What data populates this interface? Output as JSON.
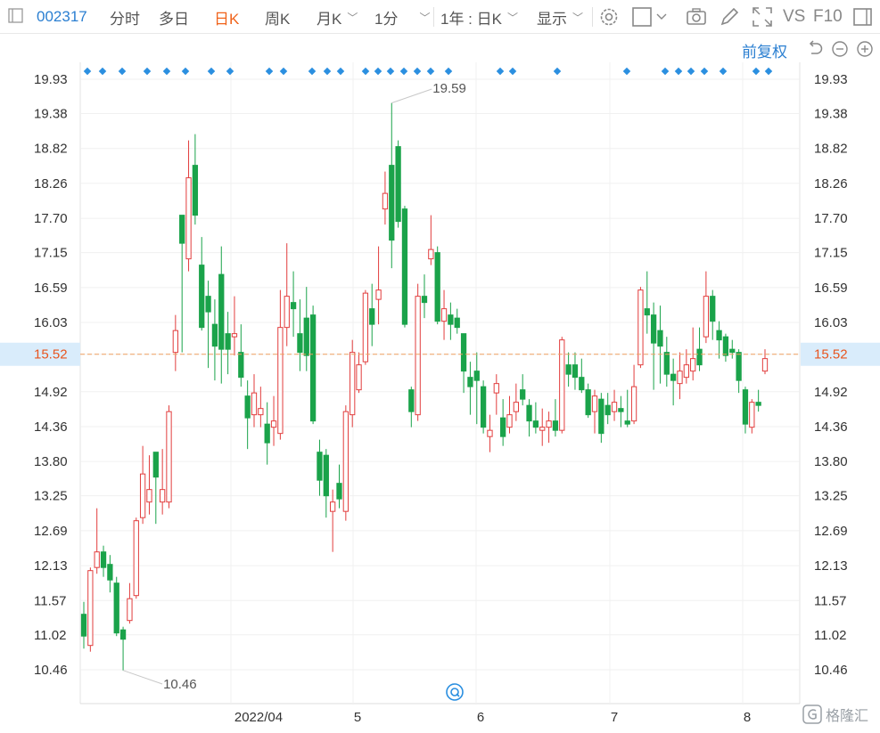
{
  "toolbar": {
    "code": "002317",
    "items": [
      "分时",
      "多日",
      "日K",
      "周K",
      "月K",
      "1分",
      "1年 : 日K",
      "显示"
    ],
    "active_index": 2,
    "vs": "VS",
    "f10": "F10"
  },
  "adjust_label": "前复权",
  "watermark": "格隆汇",
  "chart_data": {
    "type": "candlestick",
    "y_ticks": [
      "19.93",
      "19.38",
      "18.82",
      "18.26",
      "17.70",
      "17.15",
      "16.59",
      "16.03",
      "15.52",
      "14.92",
      "14.36",
      "13.80",
      "13.25",
      "12.69",
      "12.13",
      "11.57",
      "11.02",
      "10.46"
    ],
    "ylim": [
      10.46,
      19.93
    ],
    "x_labels": [
      "2022/04",
      "5",
      "6",
      "7",
      "8"
    ],
    "current_price": "15.52",
    "high_label": "19.59",
    "low_label": "10.46",
    "up_color": "#e23d3d",
    "down_color": "#1aa34a",
    "candles": [
      {
        "o": 11.35,
        "c": 11.0,
        "h": 11.55,
        "l": 10.8
      },
      {
        "o": 10.85,
        "c": 12.05,
        "h": 12.1,
        "l": 10.75
      },
      {
        "o": 12.1,
        "c": 12.35,
        "h": 13.05,
        "l": 12.0
      },
      {
        "o": 12.35,
        "c": 12.1,
        "h": 12.45,
        "l": 11.95
      },
      {
        "o": 12.15,
        "c": 11.9,
        "h": 12.3,
        "l": 11.7
      },
      {
        "o": 11.85,
        "c": 11.05,
        "h": 11.95,
        "l": 11.0
      },
      {
        "o": 11.1,
        "c": 10.95,
        "h": 11.15,
        "l": 10.45
      },
      {
        "o": 11.25,
        "c": 11.6,
        "h": 11.85,
        "l": 11.2
      },
      {
        "o": 11.65,
        "c": 12.85,
        "h": 12.9,
        "l": 11.6
      },
      {
        "o": 12.9,
        "c": 13.6,
        "h": 14.05,
        "l": 12.8
      },
      {
        "o": 13.15,
        "c": 13.35,
        "h": 13.9,
        "l": 12.95
      },
      {
        "o": 13.95,
        "c": 13.55,
        "h": 13.95,
        "l": 12.8
      },
      {
        "o": 13.15,
        "c": 13.35,
        "h": 14.0,
        "l": 12.95
      },
      {
        "o": 13.15,
        "c": 14.6,
        "h": 14.7,
        "l": 13.05
      },
      {
        "o": 15.55,
        "c": 15.9,
        "h": 16.15,
        "l": 15.25
      },
      {
        "o": 17.75,
        "c": 17.3,
        "h": 17.75,
        "l": 15.55
      },
      {
        "o": 17.05,
        "c": 18.35,
        "h": 18.95,
        "l": 16.85
      },
      {
        "o": 18.55,
        "c": 17.75,
        "h": 19.05,
        "l": 17.6
      },
      {
        "o": 16.95,
        "c": 15.95,
        "h": 17.4,
        "l": 15.9
      },
      {
        "o": 16.45,
        "c": 16.2,
        "h": 16.7,
        "l": 15.3
      },
      {
        "o": 16.0,
        "c": 15.65,
        "h": 16.4,
        "l": 15.1
      },
      {
        "o": 16.8,
        "c": 15.6,
        "h": 17.25,
        "l": 15.05
      },
      {
        "o": 15.85,
        "c": 15.6,
        "h": 16.2,
        "l": 15.2
      },
      {
        "o": 15.8,
        "c": 15.85,
        "h": 16.45,
        "l": 15.5
      },
      {
        "o": 15.55,
        "c": 15.15,
        "h": 16.0,
        "l": 15.0
      },
      {
        "o": 14.85,
        "c": 14.5,
        "h": 15.1,
        "l": 14.0
      },
      {
        "o": 14.55,
        "c": 14.9,
        "h": 15.2,
        "l": 14.35
      },
      {
        "o": 14.55,
        "c": 14.65,
        "h": 15.0,
        "l": 14.35
      },
      {
        "o": 14.4,
        "c": 14.1,
        "h": 14.75,
        "l": 13.75
      },
      {
        "o": 14.35,
        "c": 14.45,
        "h": 14.85,
        "l": 14.05
      },
      {
        "o": 14.25,
        "c": 15.95,
        "h": 16.55,
        "l": 14.15
      },
      {
        "o": 15.95,
        "c": 16.45,
        "h": 17.3,
        "l": 15.65
      },
      {
        "o": 16.35,
        "c": 16.25,
        "h": 16.85,
        "l": 15.8
      },
      {
        "o": 15.85,
        "c": 15.55,
        "h": 16.4,
        "l": 15.25
      },
      {
        "o": 16.1,
        "c": 15.5,
        "h": 16.6,
        "l": 15.25
      },
      {
        "o": 16.15,
        "c": 14.45,
        "h": 16.3,
        "l": 14.4
      },
      {
        "o": 13.95,
        "c": 13.5,
        "h": 14.15,
        "l": 13.25
      },
      {
        "o": 13.9,
        "c": 13.25,
        "h": 14.0,
        "l": 12.9
      },
      {
        "o": 13.0,
        "c": 13.15,
        "h": 13.35,
        "l": 12.35
      },
      {
        "o": 13.45,
        "c": 13.2,
        "h": 13.75,
        "l": 13.05
      },
      {
        "o": 13.0,
        "c": 14.6,
        "h": 14.7,
        "l": 12.85
      },
      {
        "o": 14.55,
        "c": 15.55,
        "h": 15.75,
        "l": 14.35
      },
      {
        "o": 14.95,
        "c": 15.35,
        "h": 15.55,
        "l": 14.9
      },
      {
        "o": 15.4,
        "c": 16.5,
        "h": 16.55,
        "l": 15.35
      },
      {
        "o": 16.25,
        "c": 16.0,
        "h": 16.65,
        "l": 15.65
      },
      {
        "o": 16.4,
        "c": 16.55,
        "h": 17.25,
        "l": 16.0
      },
      {
        "o": 17.85,
        "c": 18.1,
        "h": 18.45,
        "l": 17.6
      },
      {
        "o": 18.55,
        "c": 17.35,
        "h": 19.55,
        "l": 16.9
      },
      {
        "o": 18.85,
        "c": 17.65,
        "h": 18.95,
        "l": 17.55
      },
      {
        "o": 17.85,
        "c": 16.0,
        "h": 17.9,
        "l": 15.95
      },
      {
        "o": 14.95,
        "c": 14.6,
        "h": 15.0,
        "l": 14.35
      },
      {
        "o": 14.55,
        "c": 16.45,
        "h": 16.65,
        "l": 14.45
      },
      {
        "o": 16.45,
        "c": 16.35,
        "h": 16.8,
        "l": 16.1
      },
      {
        "o": 17.05,
        "c": 17.2,
        "h": 17.75,
        "l": 16.95
      },
      {
        "o": 17.15,
        "c": 16.05,
        "h": 17.25,
        "l": 16.0
      },
      {
        "o": 16.05,
        "c": 16.25,
        "h": 16.55,
        "l": 15.75
      },
      {
        "o": 16.15,
        "c": 16.0,
        "h": 16.35,
        "l": 15.75
      },
      {
        "o": 16.1,
        "c": 15.95,
        "h": 16.25,
        "l": 15.85
      },
      {
        "o": 15.85,
        "c": 15.25,
        "h": 15.85,
        "l": 14.9
      },
      {
        "o": 15.15,
        "c": 15.0,
        "h": 15.4,
        "l": 14.55
      },
      {
        "o": 15.25,
        "c": 15.1,
        "h": 15.55,
        "l": 14.4
      },
      {
        "o": 15.0,
        "c": 14.35,
        "h": 15.1,
        "l": 14.25
      },
      {
        "o": 14.2,
        "c": 14.3,
        "h": 14.55,
        "l": 13.95
      },
      {
        "o": 14.9,
        "c": 15.05,
        "h": 15.2,
        "l": 14.55
      },
      {
        "o": 14.5,
        "c": 14.2,
        "h": 14.8,
        "l": 14.05
      },
      {
        "o": 14.35,
        "c": 14.55,
        "h": 14.85,
        "l": 14.25
      },
      {
        "o": 14.6,
        "c": 14.75,
        "h": 15.05,
        "l": 14.45
      },
      {
        "o": 14.95,
        "c": 14.8,
        "h": 15.2,
        "l": 14.7
      },
      {
        "o": 14.7,
        "c": 14.45,
        "h": 14.8,
        "l": 14.2
      },
      {
        "o": 14.45,
        "c": 14.35,
        "h": 14.75,
        "l": 14.25
      },
      {
        "o": 14.3,
        "c": 14.35,
        "h": 14.65,
        "l": 14.05
      },
      {
        "o": 14.35,
        "c": 14.45,
        "h": 14.6,
        "l": 14.1
      },
      {
        "o": 14.45,
        "c": 14.3,
        "h": 14.8,
        "l": 14.2
      },
      {
        "o": 14.3,
        "c": 15.75,
        "h": 15.8,
        "l": 14.25
      },
      {
        "o": 15.35,
        "c": 15.2,
        "h": 15.55,
        "l": 15.0
      },
      {
        "o": 15.35,
        "c": 15.15,
        "h": 15.55,
        "l": 14.95
      },
      {
        "o": 15.15,
        "c": 14.95,
        "h": 15.45,
        "l": 14.9
      },
      {
        "o": 14.95,
        "c": 14.55,
        "h": 15.05,
        "l": 14.5
      },
      {
        "o": 14.6,
        "c": 14.85,
        "h": 14.95,
        "l": 14.25
      },
      {
        "o": 14.8,
        "c": 14.25,
        "h": 14.9,
        "l": 14.1
      },
      {
        "o": 14.7,
        "c": 14.55,
        "h": 14.9,
        "l": 14.4
      },
      {
        "o": 14.6,
        "c": 14.75,
        "h": 14.95,
        "l": 14.45
      },
      {
        "o": 14.65,
        "c": 14.6,
        "h": 14.85,
        "l": 14.35
      },
      {
        "o": 14.45,
        "c": 14.4,
        "h": 14.95,
        "l": 14.35
      },
      {
        "o": 14.45,
        "c": 15.0,
        "h": 15.35,
        "l": 14.4
      },
      {
        "o": 15.35,
        "c": 16.55,
        "h": 16.6,
        "l": 15.3
      },
      {
        "o": 16.25,
        "c": 16.15,
        "h": 16.85,
        "l": 15.85
      },
      {
        "o": 16.15,
        "c": 15.7,
        "h": 16.35,
        "l": 14.95
      },
      {
        "o": 15.9,
        "c": 15.65,
        "h": 16.3,
        "l": 15.05
      },
      {
        "o": 15.55,
        "c": 15.2,
        "h": 15.8,
        "l": 15.0
      },
      {
        "o": 15.2,
        "c": 15.1,
        "h": 15.45,
        "l": 14.7
      },
      {
        "o": 15.05,
        "c": 15.25,
        "h": 15.55,
        "l": 14.8
      },
      {
        "o": 15.15,
        "c": 15.35,
        "h": 15.6,
        "l": 15.05
      },
      {
        "o": 15.25,
        "c": 15.45,
        "h": 15.95,
        "l": 15.1
      },
      {
        "o": 15.6,
        "c": 15.35,
        "h": 15.95,
        "l": 15.25
      },
      {
        "o": 15.8,
        "c": 16.45,
        "h": 16.85,
        "l": 15.7
      },
      {
        "o": 16.45,
        "c": 16.05,
        "h": 16.55,
        "l": 15.75
      },
      {
        "o": 15.9,
        "c": 15.75,
        "h": 16.05,
        "l": 15.45
      },
      {
        "o": 15.8,
        "c": 15.5,
        "h": 15.85,
        "l": 15.4
      },
      {
        "o": 15.6,
        "c": 15.55,
        "h": 15.75,
        "l": 15.45
      },
      {
        "o": 15.55,
        "c": 15.1,
        "h": 15.6,
        "l": 14.9
      },
      {
        "o": 14.95,
        "c": 14.4,
        "h": 15.0,
        "l": 14.25
      },
      {
        "o": 14.35,
        "c": 14.75,
        "h": 14.8,
        "l": 14.25
      },
      {
        "o": 14.75,
        "c": 14.7,
        "h": 14.95,
        "l": 14.6
      },
      {
        "o": 15.25,
        "c": 15.45,
        "h": 15.6,
        "l": 15.2
      }
    ],
    "event_markers": [
      0,
      1,
      2,
      3,
      4,
      5,
      6,
      7,
      8,
      9,
      10,
      11,
      12,
      13,
      14,
      15,
      16,
      17,
      18,
      19,
      20,
      21,
      22,
      23,
      24
    ]
  }
}
